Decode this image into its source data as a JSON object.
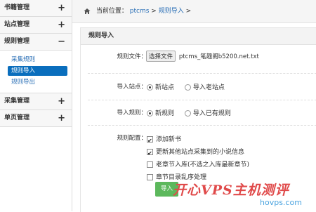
{
  "sidebar": {
    "sections": [
      {
        "label": "书籍管理",
        "toggle": "+"
      },
      {
        "label": "站点管理",
        "toggle": "+"
      },
      {
        "label": "规则管理",
        "toggle": "−"
      },
      {
        "label": "采集管理",
        "toggle": "+"
      },
      {
        "label": "单页管理",
        "toggle": "+"
      }
    ],
    "rule_items": [
      "采集规则",
      "规则导入",
      "规则导出"
    ]
  },
  "breadcrumb": {
    "prefix": "当前位置：",
    "items": [
      "ptcms",
      "规则导入"
    ],
    "sep": ">"
  },
  "panel": {
    "title": "规则导入",
    "file_label": "规则文件：",
    "file_button": "选择文件",
    "file_name": "ptcms_笔趣阁b5200.net.txt",
    "site_label": "导入站点：",
    "site_options": [
      "新站点",
      "导入老站点"
    ],
    "rule_label": "导入规则：",
    "rule_options": [
      "新规则",
      "导入已有规则"
    ],
    "config_label": "规则配置：",
    "config_options": [
      "添加新书",
      "更新其他站点采集到的小说信息",
      "老章节入库(不选之入库最新章节)",
      "章节目录乱序处理"
    ],
    "submit": "导入"
  },
  "watermark": {
    "text": "开心VPS主机测评",
    "url": "hovps.com"
  }
}
